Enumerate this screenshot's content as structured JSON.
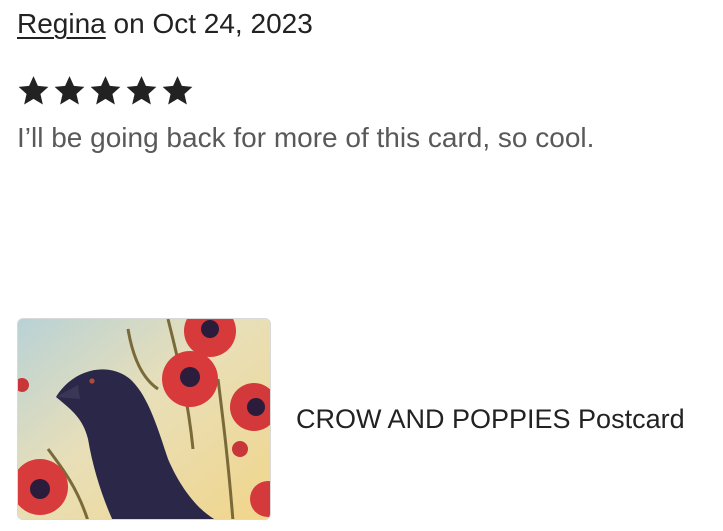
{
  "review": {
    "author": "Regina",
    "date_prefix": "on",
    "date": "Oct 24, 2023",
    "rating": 5,
    "rating_max": 5,
    "text": "I’ll be going back for more of this card, so cool."
  },
  "product": {
    "title": "CROW AND POPPIES Postcard",
    "image_icon": "crow-and-poppies-painting"
  },
  "colors": {
    "text_primary": "#222222",
    "text_secondary": "#595959",
    "star": "#222222"
  }
}
